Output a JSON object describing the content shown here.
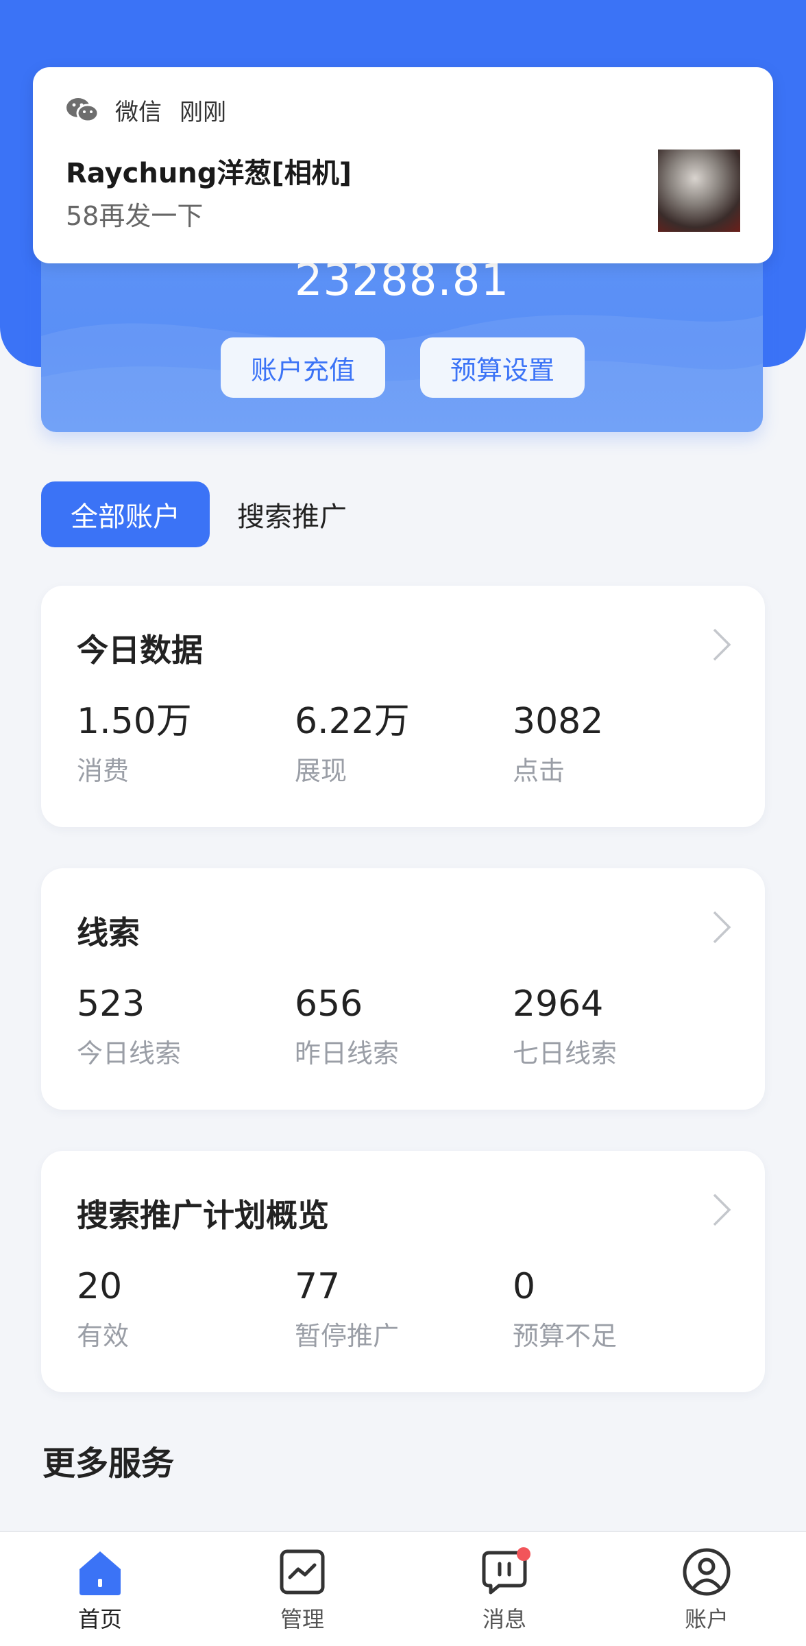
{
  "notification": {
    "app_name": "微信",
    "time": "刚刚",
    "title": "Raychung洋葱[相机]",
    "body": "58再发一下"
  },
  "balance": {
    "amount": "23288.81",
    "recharge_label": "账户充值",
    "budget_label": "预算设置"
  },
  "tabs": [
    {
      "label": "全部账户",
      "active": true
    },
    {
      "label": "搜索推广",
      "active": false
    }
  ],
  "cards": {
    "today": {
      "title": "今日数据",
      "stats": [
        {
          "value": "1.50万",
          "label": "消费"
        },
        {
          "value": "6.22万",
          "label": "展现"
        },
        {
          "value": "3082",
          "label": "点击"
        }
      ]
    },
    "leads": {
      "title": "线索",
      "stats": [
        {
          "value": "523",
          "label": "今日线索"
        },
        {
          "value": "656",
          "label": "昨日线索"
        },
        {
          "value": "2964",
          "label": "七日线索"
        }
      ]
    },
    "plans": {
      "title": "搜索推广计划概览",
      "stats": [
        {
          "value": "20",
          "label": "有效"
        },
        {
          "value": "77",
          "label": "暂停推广"
        },
        {
          "value": "0",
          "label": "预算不足"
        }
      ]
    }
  },
  "more_services": "更多服务",
  "nav": [
    {
      "label": "首页",
      "icon": "home-icon",
      "active": true
    },
    {
      "label": "管理",
      "icon": "chart-icon",
      "active": false
    },
    {
      "label": "消息",
      "icon": "message-icon",
      "active": false,
      "badge": true
    },
    {
      "label": "账户",
      "icon": "user-icon",
      "active": false
    }
  ],
  "colors": {
    "primary": "#3b73f6",
    "background": "#f3f5f9",
    "badge": "#f2555a"
  }
}
